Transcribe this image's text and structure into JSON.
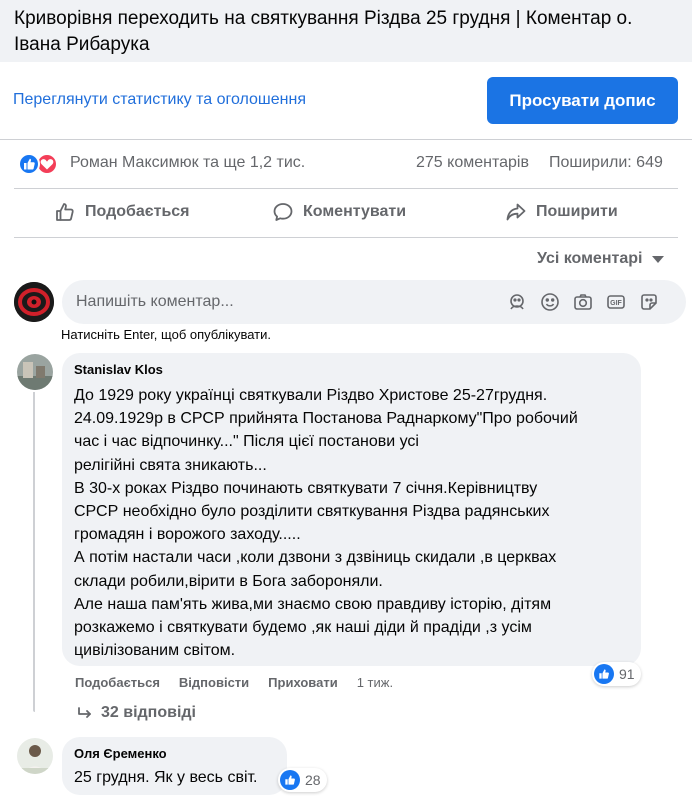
{
  "post": {
    "title": "Криворівня переходить на святкування Різдва 25 грудня | Коментар о. Івана Рибарука"
  },
  "stats_bar": {
    "link": "Переглянути статистику та оголошення",
    "promote_button": "Просувати допис"
  },
  "reactions": {
    "reactors": "Роман Максимюк та ще 1,2 тис.",
    "comments": "275 коментарів",
    "shares": "Поширили: 649"
  },
  "actions": {
    "like": "Подобається",
    "comment": "Коментувати",
    "share": "Поширити"
  },
  "filter": {
    "label": "Усі коментарі"
  },
  "composer": {
    "placeholder": "Напишіть коментар...",
    "hint": "Натисніть Enter, щоб опублікувати."
  },
  "comments": [
    {
      "author": "Stanislav Klos",
      "lines": [
        "До 1929 року українці святкували Різдво Христове 25-27грудня.",
        "24.09.1929р в СРСР прийнята Постанова Раднаркому\"Про робочий",
        "час і час відпочинку...\" Після цієї постанови усі",
        "релігійні свята зникають...",
        "В 30-х роках Різдво починають святкувати 7 січня.Керівництву",
        "СРСР необхідно було розділити святкування Різдва радянських",
        "громадян і ворожого заходу.....",
        "А потім настали часи ,коли дзвони з дзвіниць скидали ,в церквах",
        "склади робили,вірити в Бога забороняли.",
        "Але наша пам'ять жива,ми знаємо свою правдиву історію, дітям",
        "розкажемо і святкувати будемо ,як наші діди й прадіди ,з усім",
        "цивілізованим світом."
      ],
      "like_label": "Подобається",
      "reply_label": "Відповісти",
      "hide_label": "Приховати",
      "time": "1 тиж.",
      "reactions": "91",
      "replies": "32 відповіді"
    },
    {
      "author": "Оля Єременко",
      "lines": [
        "25 грудня. Як у весь світ."
      ],
      "reactions": "28"
    }
  ]
}
